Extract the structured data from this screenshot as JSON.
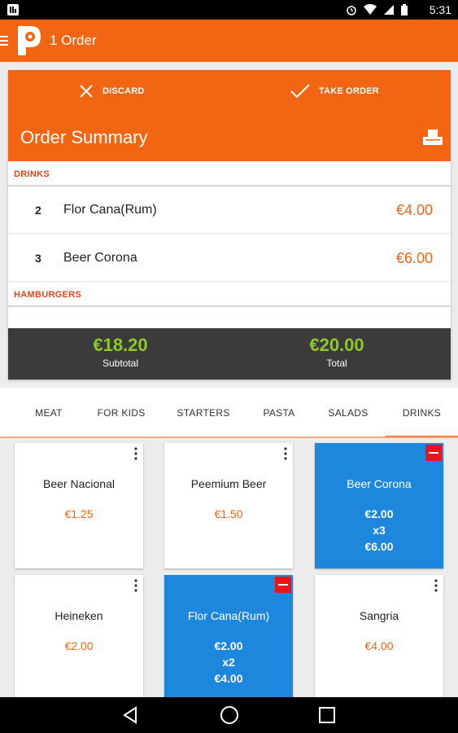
{
  "status_bar": {
    "time": "5:31"
  },
  "app_bar": {
    "title": "1 Order"
  },
  "order_summary": {
    "discard_label": "DISCARD",
    "take_order_label": "TAKE ORDER",
    "title": "Order Summary",
    "categories": [
      {
        "name": "DRINKS",
        "items": [
          {
            "qty": "2",
            "name": "Flor Cana(Rum)",
            "price": "€4.00"
          },
          {
            "qty": "3",
            "name": "Beer Corona",
            "price": "€6.00"
          }
        ]
      },
      {
        "name": "HAMBURGERS",
        "items": []
      }
    ],
    "subtotal_value": "€18.20",
    "subtotal_label": "Subtotal",
    "total_value": "€20.00",
    "total_label": "Total"
  },
  "menu_tabs": [
    "MEAT",
    "FOR KIDS",
    "STARTERS",
    "PASTA",
    "SALADS",
    "DRINKS"
  ],
  "active_tab": "DRINKS",
  "products": [
    {
      "name": "Beer Nacional",
      "price": "€1.25",
      "selected": false
    },
    {
      "name": "Peemium Beer",
      "price": "€1.50",
      "selected": false
    },
    {
      "name": "Beer Corona",
      "price": "€2.00",
      "qty": "x3",
      "total": "€6.00",
      "selected": true
    },
    {
      "name": "Heineken",
      "price": "€2.00",
      "selected": false
    },
    {
      "name": "Flor Cana(Rum)",
      "price": "€2.00",
      "qty": "x2",
      "total": "€4.00",
      "selected": true
    },
    {
      "name": "Sangria",
      "price": "€4.00",
      "selected": false
    }
  ],
  "colors": {
    "primary": "#f26512",
    "selected_card": "#1d87de",
    "total_green": "#8fc72a",
    "remove_red": "#e8151b"
  }
}
